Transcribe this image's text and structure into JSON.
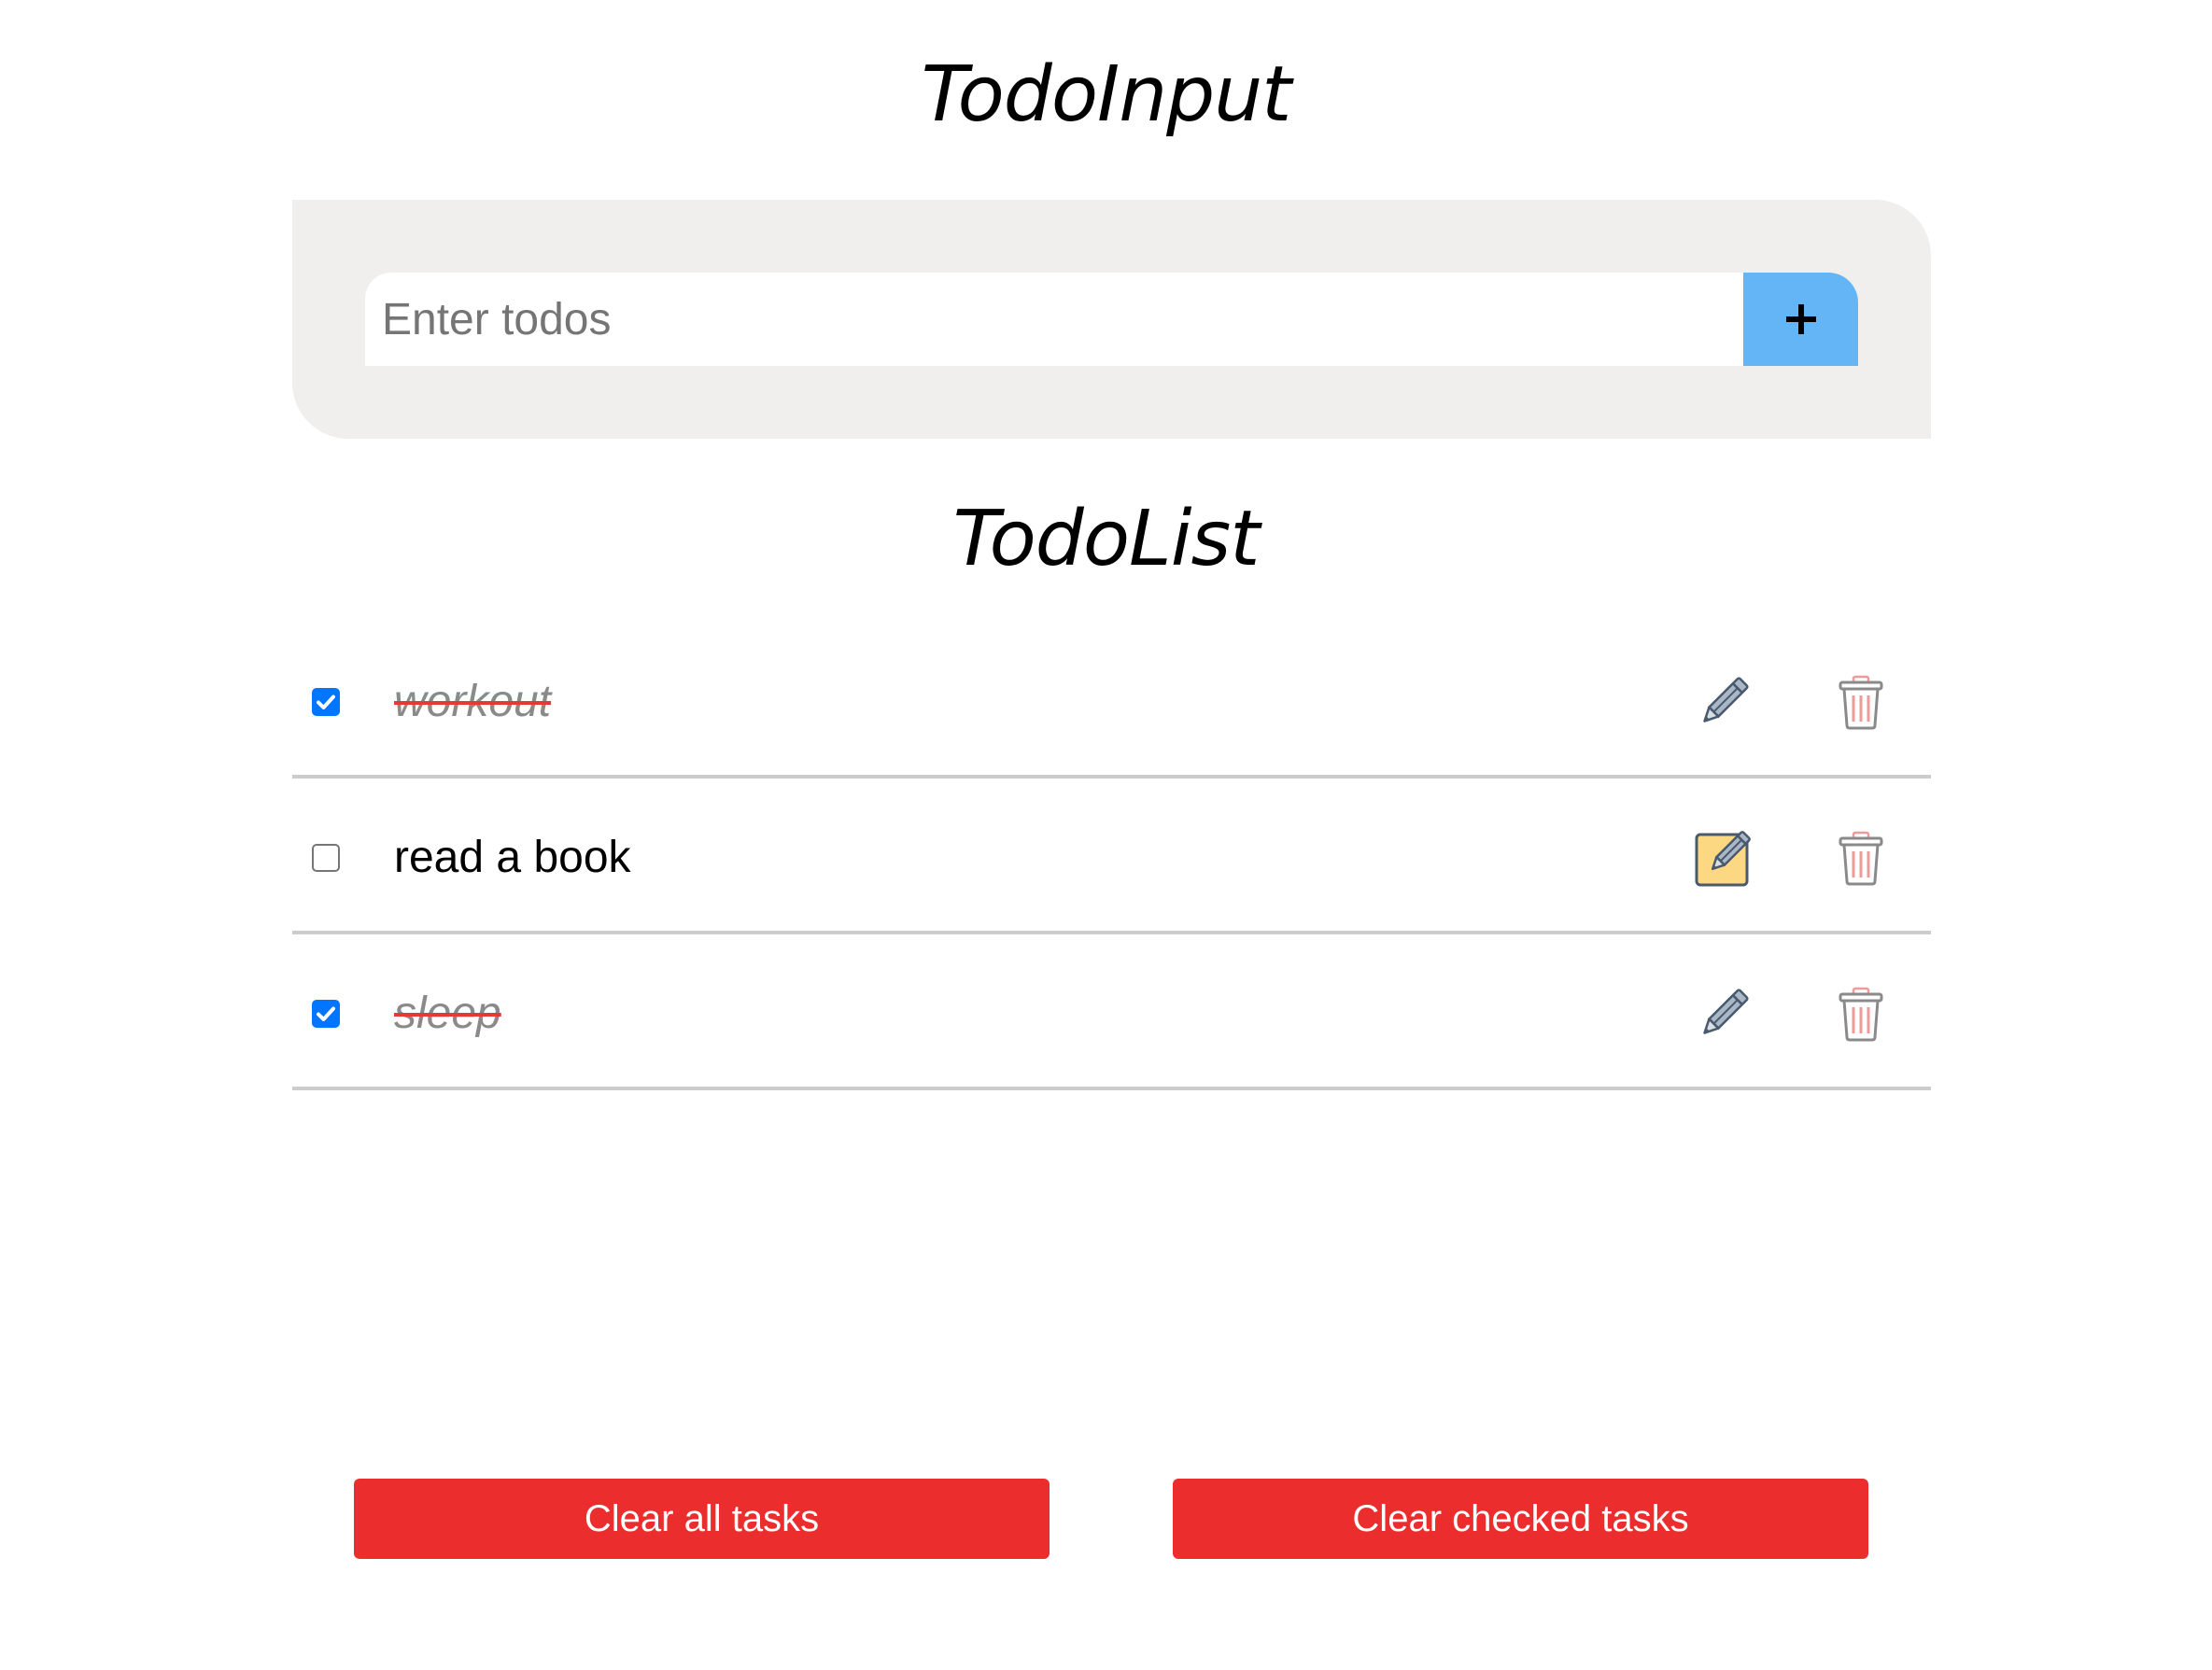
{
  "input_section": {
    "title": "TodoInput",
    "placeholder": "Enter todos",
    "value": "",
    "add_button_label": "+"
  },
  "list_section": {
    "title": "TodoList",
    "items": [
      {
        "text": "workout",
        "checked": true,
        "edit_icon": "pencil-icon",
        "delete_icon": "trash-icon"
      },
      {
        "text": "read a book",
        "checked": false,
        "edit_icon": "edit-note-icon",
        "delete_icon": "trash-icon"
      },
      {
        "text": "sleep",
        "checked": true,
        "edit_icon": "pencil-icon",
        "delete_icon": "trash-icon"
      }
    ]
  },
  "actions": {
    "clear_all_label": "Clear all tasks",
    "clear_checked_label": "Clear checked tasks"
  },
  "colors": {
    "panel_bg": "#f0efed",
    "add_button": "#64b5f6",
    "danger": "#eb2d2d",
    "strike": "#e53935",
    "checkbox": "#0075ff"
  }
}
